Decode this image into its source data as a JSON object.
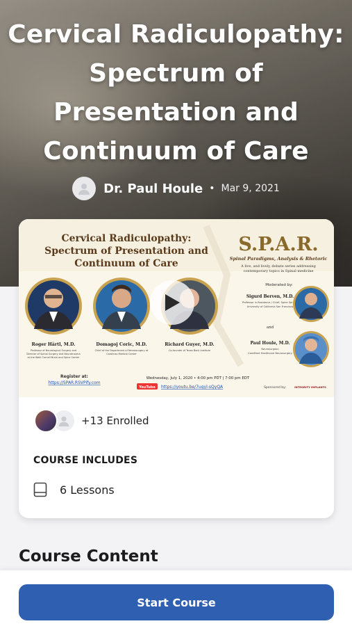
{
  "course": {
    "title": "Cervical Radiculopathy: Spectrum of Presentation and Continuum of Care",
    "author": "Dr. Paul Houle",
    "date": "Mar 9, 2021"
  },
  "thumbnail": {
    "heading": "Cervical Radiculopathy: Spectrum of Presentation and Continuum of Care",
    "brand": "S.P.A.R.",
    "brand_sub": "Spinal Paradigms, Analysis & Rhetoric",
    "brand_desc": "A live, and lively, debate series addressing contemporary topics in Spinal medicine",
    "moderated_by": "Moderated by:",
    "and_text": "and",
    "speakers": [
      {
        "name": "Roger Härtl, M.D.",
        "desc": "Professor of Neurological Surgery and Director of Spinal Surgery and Neurotrauma at the Weill Cornell Brain and Spine Center"
      },
      {
        "name": "Domagoj Coric, M.D.",
        "desc": "Chief of the Department of Neurosurgery at Carolinas Medical Center"
      },
      {
        "name": "Richard Guyer, M.D.",
        "desc": "Co-founder of Texas Back Institute"
      }
    ],
    "moderators": [
      {
        "name": "Sigurd Berven, M.D.",
        "desc": "Professor in Residence / Chief, Spine Service, University of California San Francisco"
      },
      {
        "name": "Paul Houle, M.D.",
        "desc": "Neurosurgeon, CaroMont Healthcare Neurosurgery"
      }
    ],
    "register_label": "Register at:",
    "register_link": "https://SPAR.RSVPify.com",
    "event_datetime": "Wednesday, July 1, 2020 • 4:00 pm PDT | 7:00 pm EDT",
    "youtube_label": "YouTube",
    "youtube_link": "https://youtu.be/7ugyl-sQyQA",
    "sponsor_label": "Sponsored by:",
    "sponsor_name": "INTEGRITY IMPLANTS"
  },
  "enrollment": {
    "text": "+13 Enrolled"
  },
  "includes": {
    "title": "COURSE INCLUDES",
    "lessons": "6 Lessons"
  },
  "section": {
    "content_title": "Course Content"
  },
  "actions": {
    "start_label": "Start Course"
  },
  "colors": {
    "primary": "#2f5fb0",
    "card_bg": "#ffffff",
    "page_bg": "#f3f3f5"
  }
}
